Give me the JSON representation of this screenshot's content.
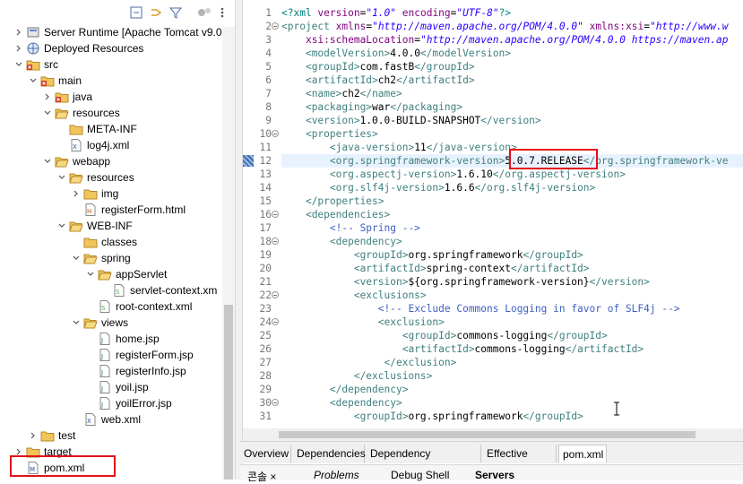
{
  "tree": {
    "items": [
      {
        "label": "Server Runtime [Apache Tomcat v9.0",
        "icon": "server-runtime-icon",
        "chev": "›"
      },
      {
        "label": "Deployed Resources",
        "icon": "globe-icon",
        "chev": "›"
      },
      {
        "label": "src",
        "icon": "folder-error-icon",
        "chev": "⌄"
      },
      {
        "label": "main",
        "icon": "folder-error-icon",
        "chev": "⌄"
      },
      {
        "label": "java",
        "icon": "folder-error-icon",
        "chev": "›"
      },
      {
        "label": "resources",
        "icon": "folder-open-icon",
        "chev": "⌄"
      },
      {
        "label": "META-INF",
        "icon": "folder-icon",
        "chev": ""
      },
      {
        "label": "log4j.xml",
        "icon": "xml-file-icon",
        "chev": ""
      },
      {
        "label": "webapp",
        "icon": "folder-open-icon",
        "chev": "⌄"
      },
      {
        "label": "resources",
        "icon": "folder-open-icon",
        "chev": "⌄"
      },
      {
        "label": "img",
        "icon": "folder-icon",
        "chev": "›"
      },
      {
        "label": "registerForm.html",
        "icon": "html-file-icon",
        "chev": ""
      },
      {
        "label": "WEB-INF",
        "icon": "folder-open-icon",
        "chev": "⌄"
      },
      {
        "label": "classes",
        "icon": "folder-icon",
        "chev": ""
      },
      {
        "label": "spring",
        "icon": "folder-open-icon",
        "chev": "⌄"
      },
      {
        "label": "appServlet",
        "icon": "folder-open-icon",
        "chev": "⌄"
      },
      {
        "label": "servlet-context.xm",
        "icon": "spring-xml-icon",
        "chev": ""
      },
      {
        "label": "root-context.xml",
        "icon": "spring-xml-icon",
        "chev": ""
      },
      {
        "label": "views",
        "icon": "folder-open-icon",
        "chev": "⌄"
      },
      {
        "label": "home.jsp",
        "icon": "jsp-file-icon",
        "chev": ""
      },
      {
        "label": "registerForm.jsp",
        "icon": "jsp-file-icon",
        "chev": ""
      },
      {
        "label": "registerInfo.jsp",
        "icon": "jsp-file-icon",
        "chev": ""
      },
      {
        "label": "yoil.jsp",
        "icon": "jsp-file-icon",
        "chev": ""
      },
      {
        "label": "yoilError.jsp",
        "icon": "jsp-file-icon",
        "chev": ""
      },
      {
        "label": "web.xml",
        "icon": "xml-file-icon",
        "chev": ""
      },
      {
        "label": "test",
        "icon": "folder-icon",
        "chev": "›"
      },
      {
        "label": "target",
        "icon": "folder-icon",
        "chev": "›"
      },
      {
        "label": "pom.xml",
        "icon": "maven-file-icon",
        "chev": ""
      }
    ]
  },
  "editor": {
    "lines": [
      {
        "n": "1",
        "fold": false,
        "html": "<span class='p'>&lt;?xml </span><span class='a'>version</span>=<span class='s'>\"1.0\"</span> <span class='a'>encoding</span>=<span class='s'>\"UTF-8\"</span><span class='p'>?&gt;</span>"
      },
      {
        "n": "2",
        "fold": true,
        "html": "<span class='t'>&lt;project</span> <span class='a'>xmlns</span>=<span class='s'>\"http://maven.apache.org/POM/4.0.0\"</span> <span class='a'>xmlns:xsi</span>=<span class='s'>\"http://www.w</span>"
      },
      {
        "n": "3",
        "fold": false,
        "html": "    <span class='a'>xsi:schemaLocation</span>=<span class='s'>\"http://maven.apache.org/POM/4.0.0 https://maven.ap</span>"
      },
      {
        "n": "4",
        "fold": false,
        "html": "    <span class='t'>&lt;modelVersion&gt;</span><span class='x'>4.0.0</span><span class='t'>&lt;/modelVersion&gt;</span>"
      },
      {
        "n": "5",
        "fold": false,
        "html": "    <span class='t'>&lt;groupId&gt;</span><span class='x'>com.fastB</span><span class='t'>&lt;/groupId&gt;</span>"
      },
      {
        "n": "6",
        "fold": false,
        "html": "    <span class='t'>&lt;artifactId&gt;</span><span class='x'>ch2</span><span class='t'>&lt;/artifactId&gt;</span>"
      },
      {
        "n": "7",
        "fold": false,
        "html": "    <span class='t'>&lt;name&gt;</span><span class='x'>ch2</span><span class='t'>&lt;/name&gt;</span>"
      },
      {
        "n": "8",
        "fold": false,
        "html": "    <span class='t'>&lt;packaging&gt;</span><span class='x'>war</span><span class='t'>&lt;/packaging&gt;</span>"
      },
      {
        "n": "9",
        "fold": false,
        "html": "    <span class='t'>&lt;version&gt;</span><span class='x'>1.0.0-BUILD-SNAPSHOT</span><span class='t'>&lt;/version&gt;</span>"
      },
      {
        "n": "10",
        "fold": true,
        "html": "    <span class='t'>&lt;properties&gt;</span>"
      },
      {
        "n": "11",
        "fold": false,
        "html": "        <span class='t'>&lt;java-version&gt;</span><span class='x'>11</span><span class='t'>&lt;/java-version&gt;</span>"
      },
      {
        "n": "12",
        "fold": false,
        "hl": true,
        "html": "        <span class='t'>&lt;org.springframework-version&gt;</span><span class='x'>5.0.7.RELEASE</span><span class='t'>&lt;/org.springframework-ve</span>"
      },
      {
        "n": "13",
        "fold": false,
        "html": "        <span class='t'>&lt;org.aspectj-version&gt;</span><span class='x'>1.6.10</span><span class='t'>&lt;/org.aspectj-version&gt;</span>"
      },
      {
        "n": "14",
        "fold": false,
        "html": "        <span class='t'>&lt;org.slf4j-version&gt;</span><span class='x'>1.6.6</span><span class='t'>&lt;/org.slf4j-version&gt;</span>"
      },
      {
        "n": "15",
        "fold": false,
        "html": "    <span class='t'>&lt;/properties&gt;</span>"
      },
      {
        "n": "16",
        "fold": true,
        "html": "    <span class='t'>&lt;dependencies&gt;</span>"
      },
      {
        "n": "17",
        "fold": false,
        "html": "        <span class='c'>&lt;!-- Spring --&gt;</span>"
      },
      {
        "n": "18",
        "fold": true,
        "html": "        <span class='t'>&lt;dependency&gt;</span>"
      },
      {
        "n": "19",
        "fold": false,
        "html": "            <span class='t'>&lt;groupId&gt;</span><span class='x'>org.springframework</span><span class='t'>&lt;/groupId&gt;</span>"
      },
      {
        "n": "20",
        "fold": false,
        "html": "            <span class='t'>&lt;artifactId&gt;</span><span class='x'>spring-context</span><span class='t'>&lt;/artifactId&gt;</span>"
      },
      {
        "n": "21",
        "fold": false,
        "html": "            <span class='t'>&lt;version&gt;</span><span class='x'>${org.springframework-version}</span><span class='t'>&lt;/version&gt;</span>"
      },
      {
        "n": "22",
        "fold": true,
        "html": "            <span class='t'>&lt;exclusions&gt;</span>"
      },
      {
        "n": "23",
        "fold": false,
        "html": "                <span class='c'>&lt;!-- Exclude Commons Logging in favor of SLF4j --&gt;</span>"
      },
      {
        "n": "24",
        "fold": true,
        "html": "                <span class='t'>&lt;exclusion&gt;</span>"
      },
      {
        "n": "25",
        "fold": false,
        "html": "                    <span class='t'>&lt;groupId&gt;</span><span class='x'>commons-logging</span><span class='t'>&lt;/groupId&gt;</span>"
      },
      {
        "n": "26",
        "fold": false,
        "html": "                    <span class='t'>&lt;artifactId&gt;</span><span class='x'>commons-logging</span><span class='t'>&lt;/artifactId&gt;</span>"
      },
      {
        "n": "27",
        "fold": false,
        "html": "                 <span class='t'>&lt;/exclusion&gt;</span>"
      },
      {
        "n": "28",
        "fold": false,
        "html": "            <span class='t'>&lt;/exclusions&gt;</span>"
      },
      {
        "n": "29",
        "fold": false,
        "html": "        <span class='t'>&lt;/dependency&gt;</span>"
      },
      {
        "n": "30",
        "fold": true,
        "html": "        <span class='t'>&lt;dependency&gt;</span>"
      },
      {
        "n": "31",
        "fold": false,
        "html": "            <span class='t'>&lt;groupId&gt;</span><span class='x'>org.springframework</span><span class='t'>&lt;/groupId&gt;</span>"
      }
    ]
  },
  "tabs": [
    "Overview",
    "Dependencies",
    "Dependency Hierarchy",
    "Effective POM",
    "pom.xml"
  ],
  "bottom_tabs": [
    "콘솔 ×",
    "Problems",
    "Debug Shell",
    "Servers"
  ],
  "colors": {
    "highlight_box": "#e3101a",
    "accent": "#2a00ff"
  }
}
